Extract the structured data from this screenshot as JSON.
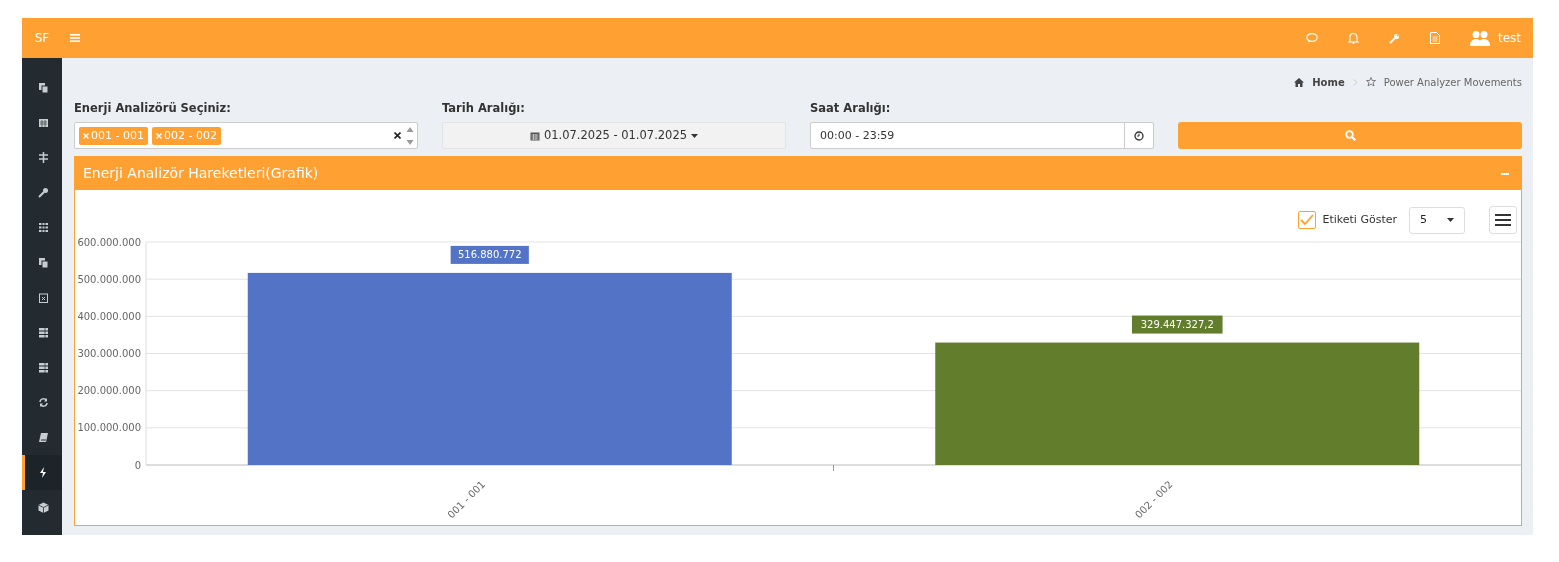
{
  "header": {
    "brand": "SF",
    "user": "test"
  },
  "sidebar": {
    "items": [
      {
        "selected": false
      },
      {
        "selected": false
      },
      {
        "selected": false
      },
      {
        "selected": false
      },
      {
        "selected": false
      },
      {
        "selected": false
      },
      {
        "selected": false
      },
      {
        "selected": false
      },
      {
        "selected": false
      },
      {
        "selected": false
      },
      {
        "selected": false
      },
      {
        "selected": true
      },
      {
        "selected": false
      }
    ]
  },
  "breadcrumb": {
    "home": "Home",
    "current": "Power Analyzer Movements"
  },
  "filters": {
    "analyzer": {
      "label": "Enerji Analizörü Seçiniz:",
      "tags": [
        "001 - 001",
        "002 - 002"
      ]
    },
    "date": {
      "label": "Tarih Aralığı:",
      "value": "01.07.2025 - 01.07.2025"
    },
    "time": {
      "label": "Saat Aralığı:",
      "value": "00:00 - 23:59"
    }
  },
  "panel": {
    "title": "Enerji Analizör Hareketleri(Grafik)",
    "toolbar": {
      "show_labels": {
        "label": "Etiketi Göster",
        "checked": true
      },
      "count": "5"
    },
    "chart_data": {
      "type": "bar",
      "categories": [
        "001 - 001",
        "002 - 002"
      ],
      "series": [
        {
          "color": "#5373c7",
          "values": [
            516880772,
            null
          ]
        },
        {
          "color": "#627d2c",
          "values": [
            null,
            329447327.2
          ]
        }
      ],
      "ylim": [
        0,
        600000000
      ],
      "grid": true,
      "yticks": [
        {
          "value": 0,
          "label": "0"
        },
        {
          "value": 100000000,
          "label": "100.000.000"
        },
        {
          "value": 200000000,
          "label": "200.000.000"
        },
        {
          "value": 300000000,
          "label": "300.000.000"
        },
        {
          "value": 400000000,
          "label": "400.000.000"
        },
        {
          "value": 500000000,
          "label": "500.000.000"
        },
        {
          "value": 600000000,
          "label": "600.000.000"
        }
      ],
      "value_labels": [
        "516.880.772",
        "329.447.327,2"
      ]
    }
  }
}
